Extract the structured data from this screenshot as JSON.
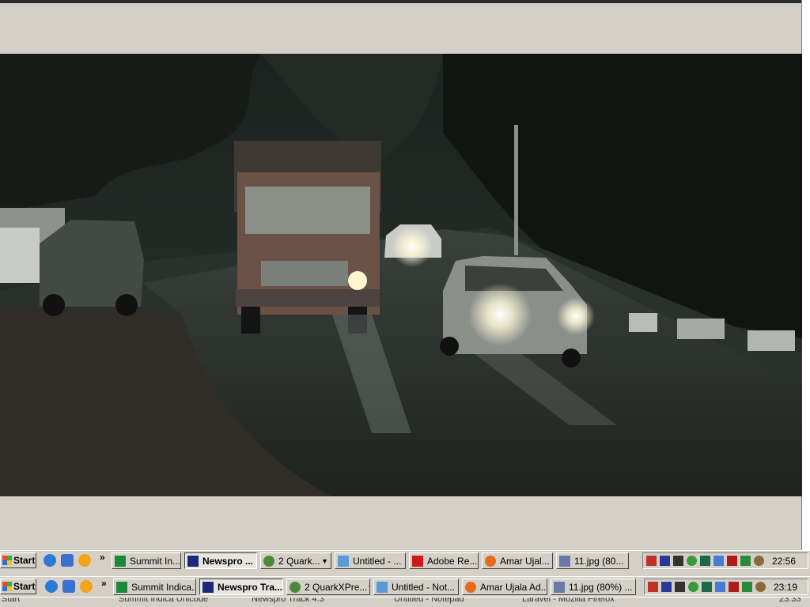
{
  "taskbar_primary": {
    "start_label": "Start",
    "quick_launch_icons": [
      "ie-icon",
      "desktop-icon",
      "media-player-icon"
    ],
    "chevron": "»",
    "tasks": [
      {
        "label": "Summit In...",
        "icon": "summit-icon",
        "active": false
      },
      {
        "label": "Newspro ...",
        "icon": "newspro-icon",
        "active": true
      },
      {
        "label": "2 Quark...",
        "icon": "quark-icon",
        "active": false
      },
      {
        "label": "Untitled - ...",
        "icon": "notepad-icon",
        "active": false
      },
      {
        "label": "Adobe Re...",
        "icon": "acrobat-icon",
        "active": false
      },
      {
        "label": "Amar Ujal...",
        "icon": "firefox-icon",
        "active": false
      },
      {
        "label": "11.jpg (80...",
        "icon": "image-viewer-icon",
        "active": false
      }
    ],
    "clock": "22:56"
  },
  "taskbar_secondary": {
    "start_label": "Start",
    "chevron": "»",
    "tasks": [
      {
        "label": "Summit Indica...",
        "icon": "summit-icon",
        "active": false
      },
      {
        "label": "Newspro Tra...",
        "icon": "newspro-icon",
        "active": true
      },
      {
        "label": "2 QuarkXPre...",
        "icon": "quark-icon",
        "active": false
      },
      {
        "label": "Untitled - Not...",
        "icon": "notepad-icon",
        "active": false
      },
      {
        "label": "Amar Ujala Ad...",
        "icon": "firefox-icon",
        "active": false
      },
      {
        "label": "11.jpg (80%) ...",
        "icon": "image-viewer-icon",
        "active": false
      }
    ],
    "clock": "23:19"
  },
  "taskbar_tertiary": {
    "start_label": "Start",
    "tasks": [
      "Summit Indica Unicode",
      "Newspro Track 4.3",
      "Untitled - Notepad",
      "Laravel - Mozilla Firefox"
    ],
    "clock": "23:33"
  },
  "tray_icons": [
    "shield-icon",
    "network-icon",
    "sound-icon",
    "globe-icon",
    "n-icon",
    "puzzle-icon",
    "f-icon",
    "v2-icon",
    "people-icon"
  ],
  "colors": {
    "taskbar_bg": "#d4d0c8",
    "summit_green": "#1a8a3a",
    "newspro_navy": "#1a2a7a",
    "acrobat_red": "#cc1a1a",
    "firefox_orange": "#e66a1a"
  }
}
